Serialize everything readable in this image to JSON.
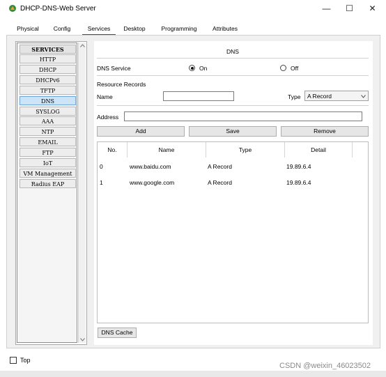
{
  "window": {
    "title": "DHCP-DNS-Web Server",
    "minimize": "—",
    "maximize": "☐",
    "close": "✕"
  },
  "tabs": [
    "Physical",
    "Config",
    "Services",
    "Desktop",
    "Programming",
    "Attributes"
  ],
  "active_tab": "Services",
  "services": {
    "header": "SERVICES",
    "items": [
      "HTTP",
      "DHCP",
      "DHCPv6",
      "TFTP",
      "DNS",
      "SYSLOG",
      "AAA",
      "NTP",
      "EMAIL",
      "FTP",
      "IoT",
      "VM Management",
      "Radius EAP"
    ],
    "selected": "DNS"
  },
  "dns": {
    "section_title": "DNS",
    "service_label": "DNS Service",
    "on_label": "On",
    "off_label": "Off",
    "service_state": "On",
    "resource_records_label": "Resource Records",
    "name_label": "Name",
    "name_value": "",
    "type_label": "Type",
    "type_value": "A Record",
    "address_label": "Address",
    "address_value": "",
    "add_button": "Add",
    "save_button": "Save",
    "remove_button": "Remove",
    "dns_cache_button": "DNS Cache"
  },
  "table": {
    "columns": [
      "No.",
      "Name",
      "Type",
      "Detail"
    ],
    "rows": [
      {
        "no": "0",
        "name": "www.baidu.com",
        "type": "A Record",
        "detail": "19.89.6.4"
      },
      {
        "no": "1",
        "name": "www.google.com",
        "type": "A Record",
        "detail": "19.89.6.4"
      }
    ]
  },
  "footer": {
    "top_label": "Top",
    "watermark": "CSDN @weixin_46023502"
  },
  "colors": {
    "accent": "#1e5b8c",
    "selected_bg": "#cde4f7"
  }
}
